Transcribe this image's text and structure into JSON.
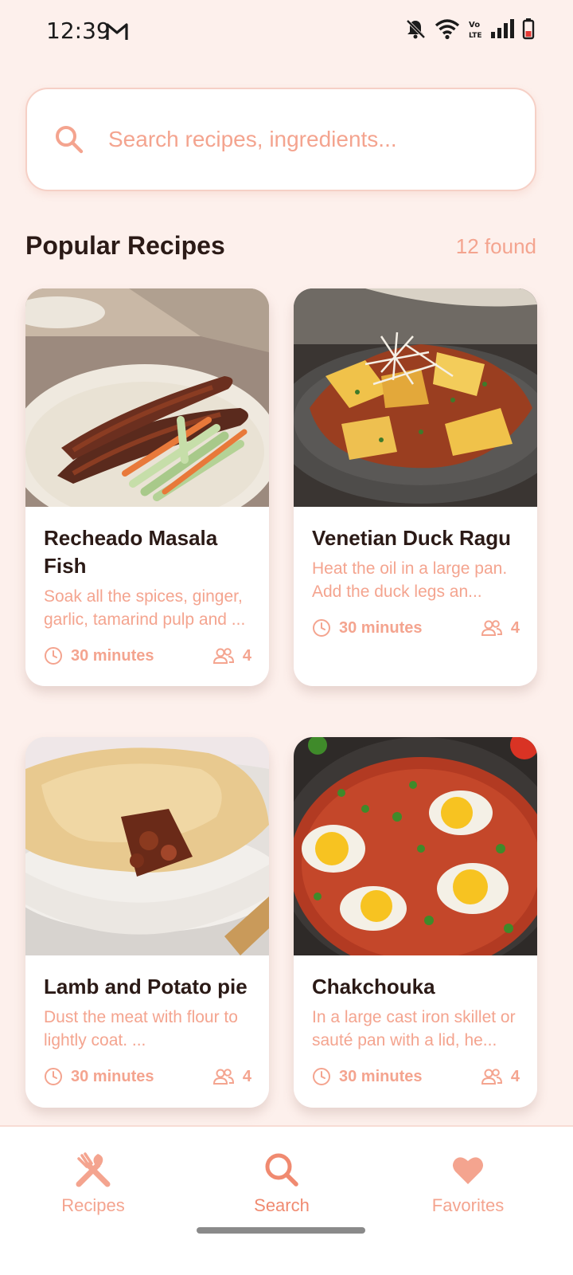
{
  "status_bar": {
    "time": "12:39",
    "icons": [
      "gmail-icon",
      "bell-off-icon",
      "wifi-icon",
      "volte-icon",
      "signal-icon",
      "battery-icon"
    ]
  },
  "search": {
    "placeholder": "Search recipes, ingredients...",
    "value": ""
  },
  "section": {
    "title": "Popular Recipes",
    "count_label": "12 found"
  },
  "recipes": [
    {
      "title": "Recheado Masala Fish",
      "description": "Soak all the spices, ginger, garlic, tamarind pulp and ...",
      "time": "30 minutes",
      "servings": "4",
      "image": "fried-fish-photo"
    },
    {
      "title": "Venetian Duck Ragu",
      "description": "Heat the oil in a large pan. Add the duck legs an...",
      "time": "30 minutes",
      "servings": "4",
      "image": "pasta-ragu-photo"
    },
    {
      "title": "Lamb and Potato pie",
      "description": "Dust the meat with flour to lightly coat. ...",
      "time": "30 minutes",
      "servings": "4",
      "image": "meat-pie-photo"
    },
    {
      "title": "Chakchouka",
      "description": "In a large cast iron skillet or sauté pan with a lid, he...",
      "time": "30 minutes",
      "servings": "4",
      "image": "shakshuka-photo"
    }
  ],
  "nav": {
    "items": [
      {
        "label": "Recipes",
        "icon": "utensils-icon"
      },
      {
        "label": "Search",
        "icon": "search-icon",
        "active": true
      },
      {
        "label": "Favorites",
        "icon": "heart-icon"
      }
    ]
  },
  "colors": {
    "background": "#fdf0ec",
    "accent": "#f4a48f",
    "accent_active": "#f08a70",
    "text_dark": "#2b1a16"
  }
}
